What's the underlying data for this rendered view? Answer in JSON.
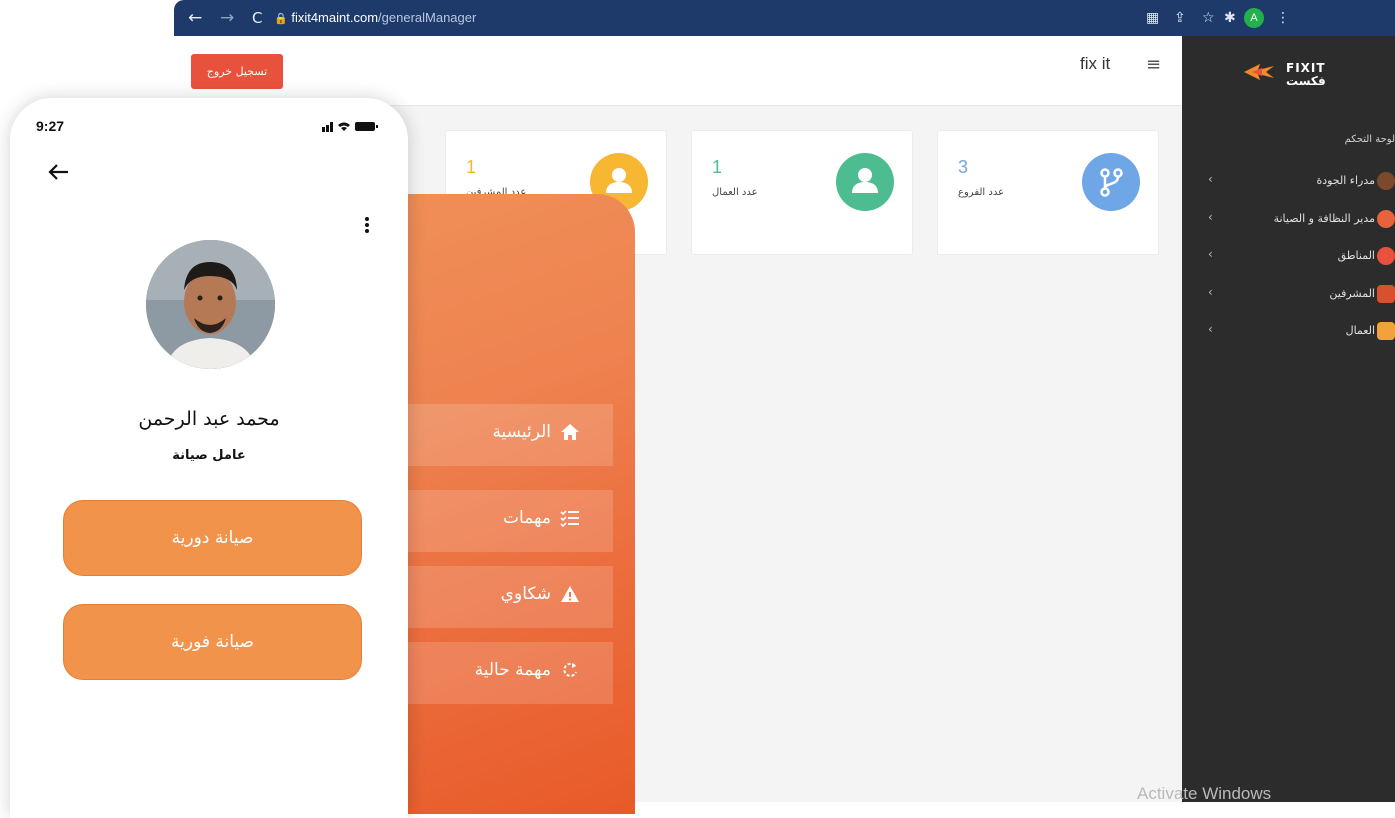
{
  "browser": {
    "url_domain": "fixit4maint.com",
    "url_path": "/generalManager",
    "profile_initial": "A"
  },
  "header": {
    "logout_label": "تسجيل خروج",
    "brand": "fix it"
  },
  "stats": [
    {
      "value": "3",
      "label": "عدد الفروع",
      "color": "#6fa6e6",
      "icon": "branch-icon"
    },
    {
      "value": "1",
      "label": "عدد العمال",
      "color": "#4dbd91",
      "icon": "user-icon"
    },
    {
      "value": "1",
      "label": "عدد المشرفين",
      "color": "#f7b733",
      "icon": "user-icon"
    }
  ],
  "sidebar": {
    "logo_text": "FIXIT فكست",
    "dashboard": "لوحة التحكم",
    "items": [
      {
        "label": "مدراء الجودة",
        "icon": "manager-icon"
      },
      {
        "label": "مدير النظافة و الصيانة",
        "icon": "bulb-icon"
      },
      {
        "label": "المناطق",
        "icon": "pin-icon"
      },
      {
        "label": "المشرفين",
        "icon": "supervisor-icon"
      },
      {
        "label": "العمال",
        "icon": "worker-icon"
      }
    ]
  },
  "mobile_menu": [
    {
      "label": "الرئيسية",
      "icon": "home-icon"
    },
    {
      "label": "مهمات",
      "icon": "tasks-list-icon"
    },
    {
      "label": "شكاوي",
      "icon": "warning-icon"
    },
    {
      "label": "مهمة حالية",
      "icon": "refresh-icon"
    }
  ],
  "phone": {
    "time": "9:27",
    "name": "محمد عبد الرحمن",
    "role": "عامل صيانة",
    "buttons": [
      "صيانة دورية",
      "صيانة فورية"
    ]
  },
  "watermark": "Activate Windows",
  "colors": {
    "accent": "#f2934c",
    "logout": "#e8523c",
    "sidebar": "#2c2c2c"
  }
}
